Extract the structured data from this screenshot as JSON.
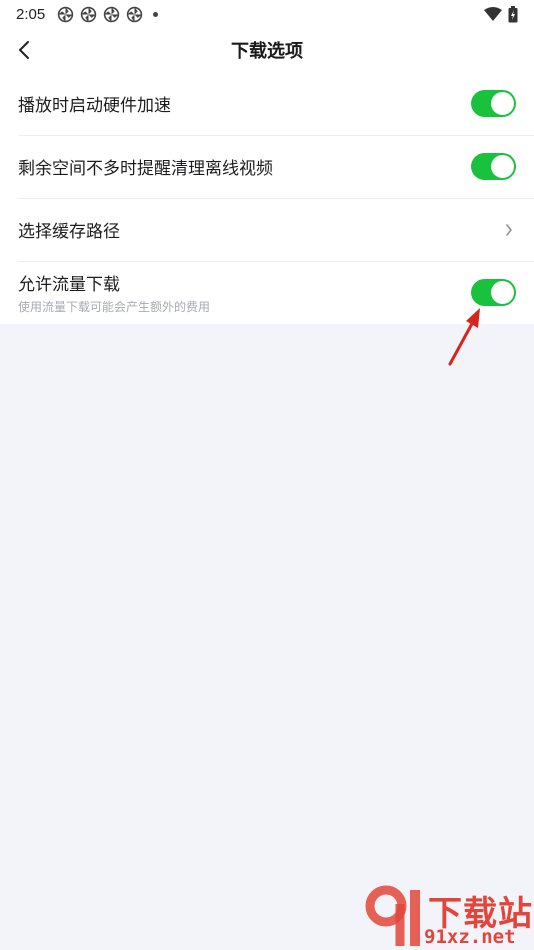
{
  "status_bar": {
    "time": "2:05",
    "notification_icons": [
      "pinwheel-icon",
      "pinwheel-icon",
      "pinwheel-icon",
      "pinwheel-icon"
    ],
    "right_icons": [
      "wifi-icon",
      "battery-icon"
    ]
  },
  "header": {
    "title": "下载选项",
    "back_icon": "chevron-left-icon"
  },
  "settings": [
    {
      "label": "播放时启动硬件加速",
      "control": "toggle",
      "on": true
    },
    {
      "label": "剩余空间不多时提醒清理离线视频",
      "control": "toggle",
      "on": true
    },
    {
      "label": "选择缓存路径",
      "control": "chevron"
    },
    {
      "label": "允许流量下载",
      "sublabel": "使用流量下载可能会产生额外的费用",
      "control": "toggle",
      "on": true
    }
  ],
  "colors": {
    "toggle_on": "#19c23c",
    "background": "#f2f4f9",
    "annotation_arrow": "#d7251d",
    "watermark": "#e4453a"
  },
  "watermark": {
    "line1": "下载站",
    "line2": "91xz.net"
  }
}
